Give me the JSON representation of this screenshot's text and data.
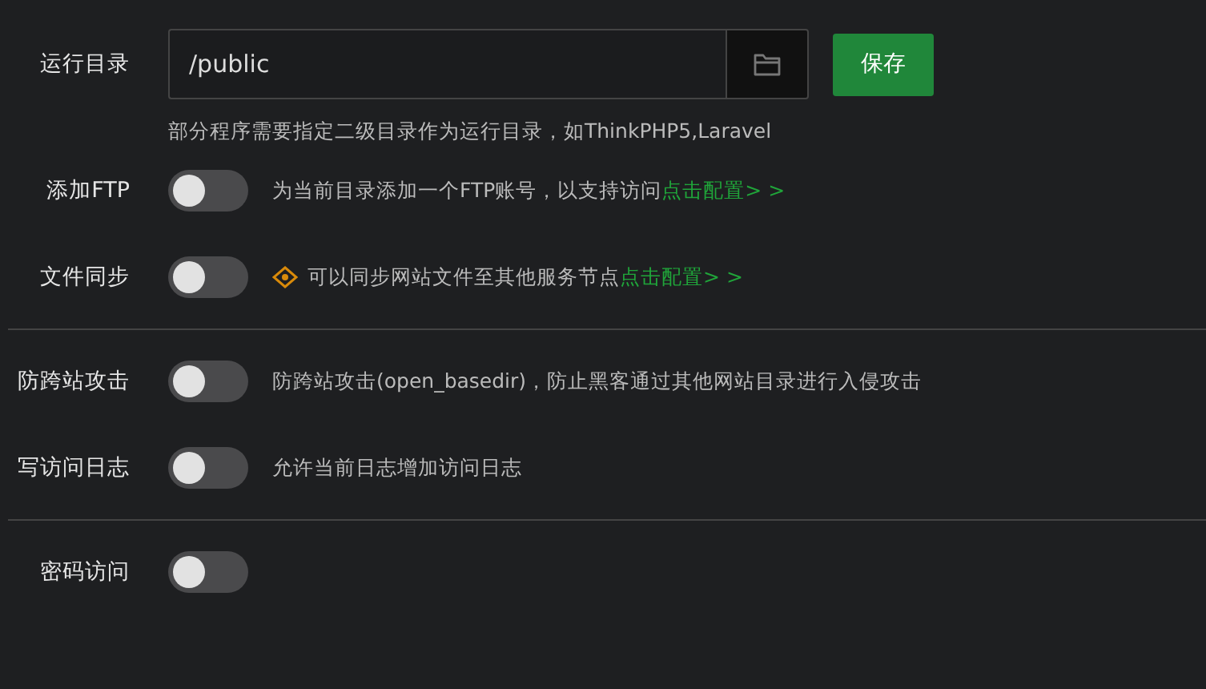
{
  "run_dir": {
    "label": "运行目录",
    "value": "/public",
    "save_button": "保存",
    "hint": "部分程序需要指定二级目录作为运行目录，如ThinkPHP5,Laravel"
  },
  "groups": [
    {
      "items": [
        {
          "label": "添加FTP",
          "on": false,
          "icon": false,
          "description": "为当前目录添加一个FTP账号，以支持访问",
          "link": "点击配置> >"
        },
        {
          "label": "文件同步",
          "on": false,
          "icon": true,
          "description": "可以同步网站文件至其他服务节点",
          "link": "点击配置> >"
        }
      ]
    },
    {
      "items": [
        {
          "label": "防跨站攻击",
          "on": false,
          "icon": false,
          "description": "防跨站攻击(open_basedir)，防止黑客通过其他网站目录进行入侵攻击"
        },
        {
          "label": "写访问日志",
          "on": false,
          "icon": false,
          "description": "允许当前日志增加访问日志"
        }
      ]
    },
    {
      "items": [
        {
          "label": "密码访问",
          "on": false,
          "icon": false
        }
      ]
    }
  ]
}
